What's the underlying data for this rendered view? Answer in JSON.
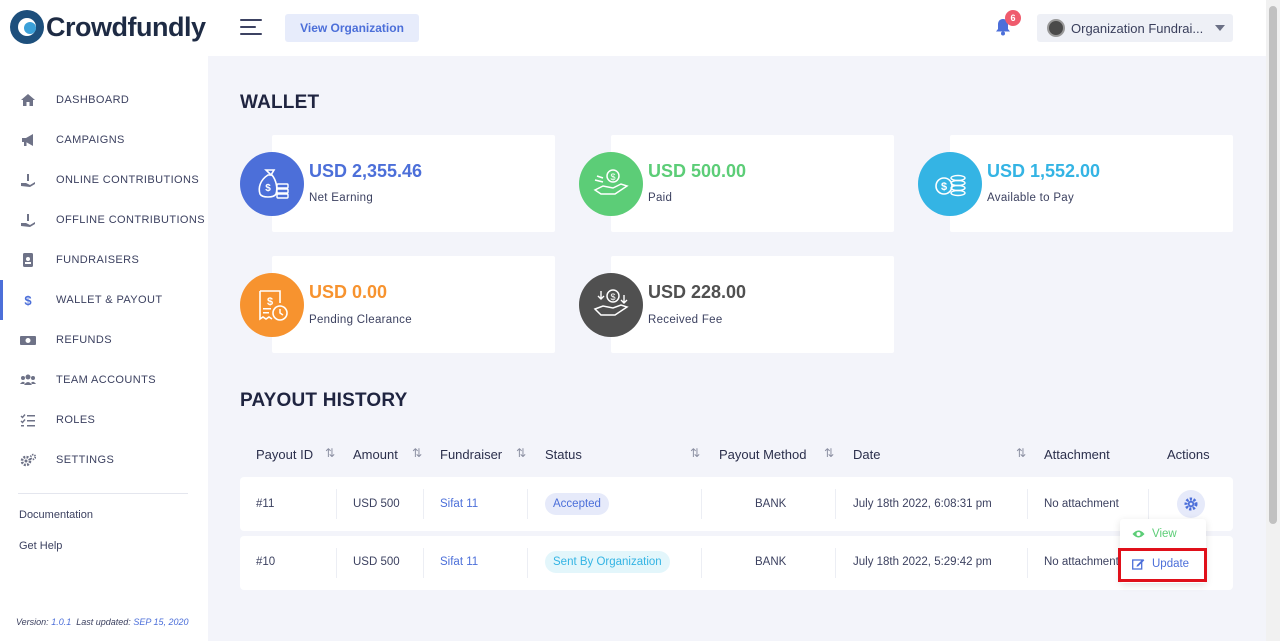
{
  "app": {
    "logo_text": "Crowdfundly"
  },
  "header": {
    "view_org_label": "View Organization",
    "notification_count": "6",
    "org_name": "Organization Fundrai..."
  },
  "sidebar": {
    "items": [
      {
        "label": "DASHBOARD",
        "icon": "home-icon"
      },
      {
        "label": "CAMPAIGNS",
        "icon": "megaphone-icon"
      },
      {
        "label": "ONLINE CONTRIBUTIONS",
        "icon": "hand-donate-icon"
      },
      {
        "label": "OFFLINE CONTRIBUTIONS",
        "icon": "hand-donate-icon"
      },
      {
        "label": "FUNDRAISERS",
        "icon": "id-badge-icon"
      },
      {
        "label": "WALLET & PAYOUT",
        "icon": "dollar-icon",
        "active": true
      },
      {
        "label": "REFUNDS",
        "icon": "money-bill-icon"
      },
      {
        "label": "TEAM ACCOUNTS",
        "icon": "users-icon"
      },
      {
        "label": "ROLES",
        "icon": "tasks-icon"
      },
      {
        "label": "SETTINGS",
        "icon": "gears-icon"
      }
    ],
    "links": {
      "documentation": "Documentation",
      "help": "Get Help"
    },
    "version": {
      "prefix": "Version:",
      "number": "1.0.1",
      "updated_prefix": "Last updated:",
      "updated_date": "SEP 15, 2020"
    }
  },
  "wallet": {
    "title": "WALLET",
    "cards": [
      {
        "amount": "USD 2,355.46",
        "label": "Net Earning",
        "color": "#4c6fd9",
        "icon": "money-bag-icon"
      },
      {
        "amount": "USD 500.00",
        "label": "Paid",
        "color": "#5ccd77",
        "icon": "hand-money-icon"
      },
      {
        "amount": "USD 1,552.00",
        "label": "Available to Pay",
        "color": "#34b4e4",
        "icon": "coins-icon"
      },
      {
        "amount": "USD 0.00",
        "label": "Pending Clearance",
        "color": "#f7932f",
        "icon": "receipt-clock-icon"
      },
      {
        "amount": "USD 228.00",
        "label": "Received Fee",
        "color": "#505050",
        "icon": "fee-hand-icon"
      }
    ]
  },
  "payout_history": {
    "title": "PAYOUT HISTORY",
    "columns": [
      "Payout ID",
      "Amount",
      "Fundraiser",
      "Status",
      "Payout Method",
      "Date",
      "Attachment",
      "Actions"
    ],
    "rows": [
      {
        "id": "#11",
        "amount": "USD 500",
        "fundraiser": "Sifat 11",
        "status": "Accepted",
        "method": "BANK",
        "date": "July 18th 2022, 6:08:31 pm",
        "attachment": "No attachment"
      },
      {
        "id": "#10",
        "amount": "USD 500",
        "fundraiser": "Sifat 11",
        "status": "Sent By Organization",
        "method": "BANK",
        "date": "July 18th 2022, 5:29:42 pm",
        "attachment": "No attachment"
      }
    ],
    "action_menu": {
      "view": "View",
      "update": "Update"
    }
  },
  "colors": {
    "accent": "#4c6fd9",
    "success": "#5ccd77",
    "highlight": "#e0101a"
  }
}
